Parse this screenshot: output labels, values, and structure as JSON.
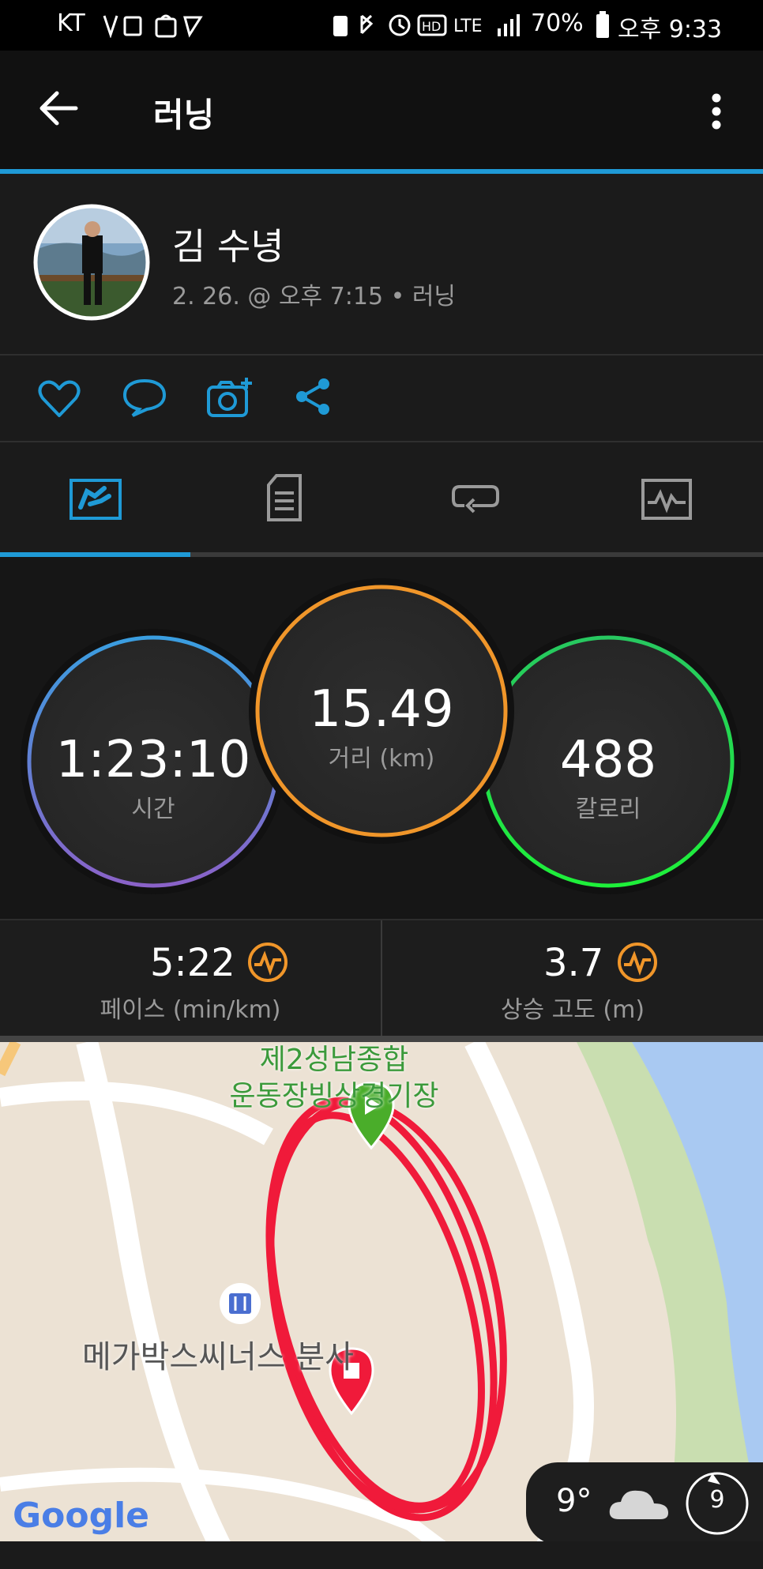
{
  "status_bar": {
    "carrier": "KT",
    "battery": "70%",
    "time": "오후 9:33"
  },
  "app_bar": {
    "title": "러닝"
  },
  "profile": {
    "name": "김 수녕",
    "meta": "2. 26. @ 오후 7:15 • 러닝"
  },
  "stats": {
    "time": {
      "value": "1:23:10",
      "label": "시간"
    },
    "distance": {
      "value": "15.49",
      "label": "거리 (km)"
    },
    "calories": {
      "value": "488",
      "label": "칼로리"
    }
  },
  "metrics": {
    "pace": {
      "value": "5:22",
      "label": "페이스 (min/km)"
    },
    "elevation": {
      "value": "3.7",
      "label": "상승 고도 (m)"
    }
  },
  "map": {
    "place_label_line1": "제2성남종합",
    "place_label_line2": "운동장빙상경기장",
    "poi_label": "메가박스씨너스 분사",
    "logo": "Google"
  },
  "weather": {
    "temp": "9°",
    "wind": "9"
  },
  "colors": {
    "accent": "#1f9ad6",
    "distance_ring": "#f0962a",
    "calories_ring": "#27d04a",
    "time_ring": "#3a9ee0",
    "route": "#f01a3a"
  }
}
